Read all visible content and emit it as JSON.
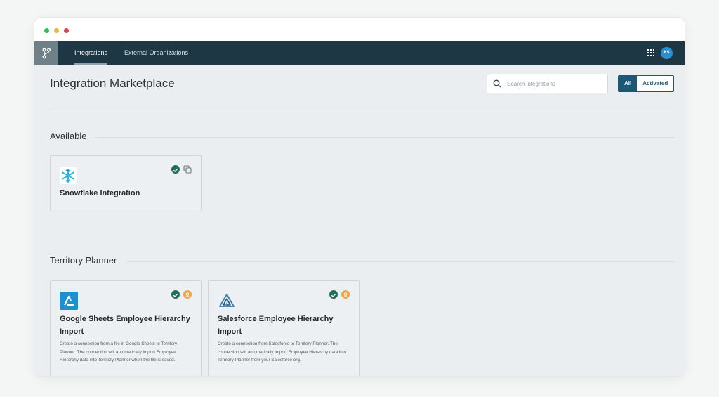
{
  "nav": {
    "tabs": [
      {
        "label": "Integrations",
        "active": true
      },
      {
        "label": "External Organizations",
        "active": false
      }
    ],
    "avatar_initials": "KS"
  },
  "page": {
    "title": "Integration Marketplace",
    "search_placeholder": "Search integrations",
    "filter": {
      "all": "All",
      "activated": "Activated",
      "selected": "All"
    }
  },
  "sections": [
    {
      "title": "Available",
      "cards": [
        {
          "title": "Snowflake Integration",
          "logo": "snowflake-logo",
          "badges": [
            "check-icon",
            "duplicate-icon"
          ]
        }
      ]
    },
    {
      "title": "Territory Planner",
      "cards": [
        {
          "title": "Google Sheets Employee Hierarchy Import",
          "logo": "sheets-import-logo",
          "badges": [
            "check-icon",
            "person-icon"
          ],
          "description": "Create a connection from a file in Google Sheets to Territory Planner. The connection will automatically import Employee Hierarchy data into Territory Planner when the file is saved."
        },
        {
          "title": "Salesforce Employee Hierarchy Import",
          "logo": "salesforce-import-logo",
          "badges": [
            "check-icon",
            "person-icon"
          ],
          "description": "Create a connection from Salesforce to Territory Planner. The connection will automatically import Employee Hierarchy data into Territory Planner from your Salesforce org."
        }
      ]
    }
  ],
  "colors": {
    "appbar": "#1e3744",
    "accent": "#1b5873",
    "check": "#1d6f58",
    "person": "#f4a23f",
    "avatar": "#2b8fd4"
  }
}
